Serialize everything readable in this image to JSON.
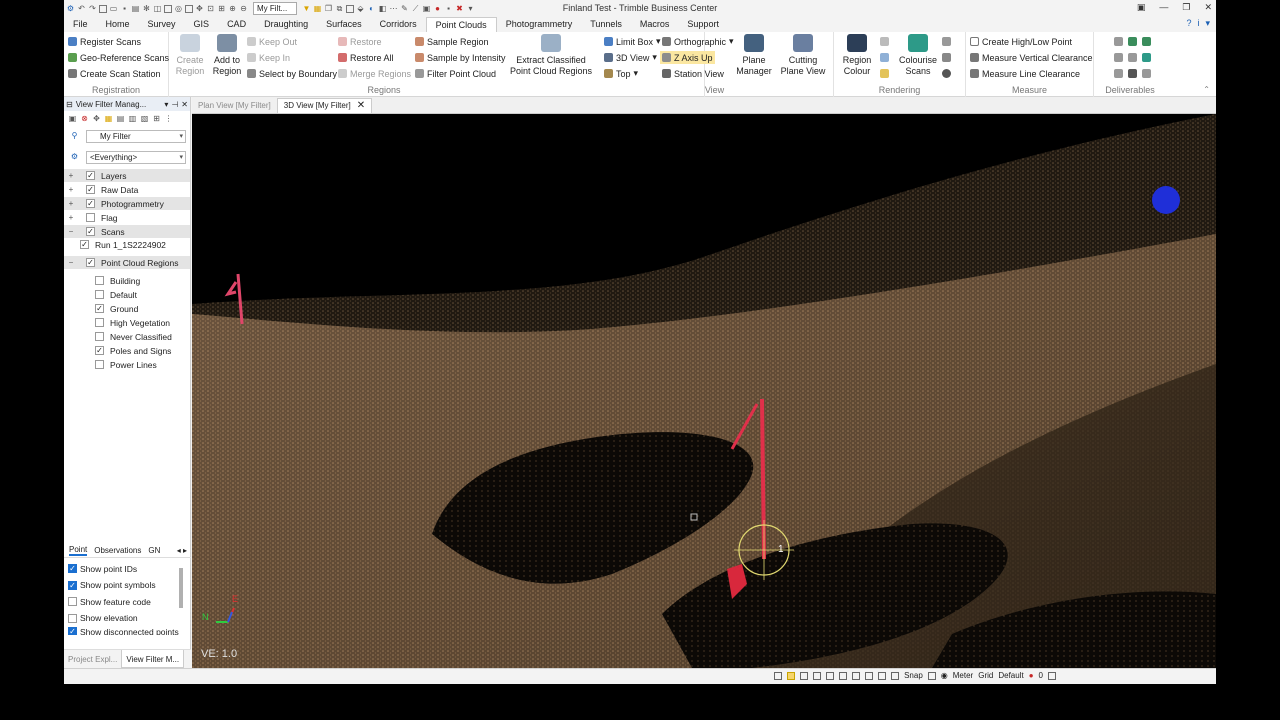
{
  "window": {
    "title": "Finland Test - Trimble Business Center",
    "qat_filter": "My Filt..."
  },
  "tabs": [
    "File",
    "Home",
    "Survey",
    "GIS",
    "CAD",
    "Draughting",
    "Surfaces",
    "Corridors",
    "Point Clouds",
    "Photogrammetry",
    "Tunnels",
    "Macros",
    "Support"
  ],
  "active_tab": "Point Clouds",
  "ribbon": {
    "registration": {
      "label": "Registration",
      "items": [
        "Register Scans",
        "Geo-Reference Scans",
        "Create Scan Station"
      ]
    },
    "regions": {
      "label": "Regions",
      "create_region": "Create Region",
      "add_to_region": "Add to Region",
      "keep_out": "Keep Out",
      "keep_in": "Keep In",
      "select_by_boundary": "Select by Boundary",
      "restore": "Restore",
      "restore_all": "Restore All",
      "merge_regions": "Merge Regions",
      "sample_region": "Sample Region",
      "sample_by_intensity": "Sample by Intensity",
      "filter_point_cloud": "Filter Point Cloud",
      "extract_classified": "Extract Classified Point Cloud Regions"
    },
    "view": {
      "label": "View",
      "limit_box": "Limit Box",
      "orthographic": "Orthographic",
      "view_3d": "3D View",
      "z_axis_up": "Z Axis Up",
      "top": "Top",
      "station_view": "Station View",
      "plane_manager": "Plane Manager",
      "cutting_plane_view": "Cutting Plane View"
    },
    "rendering": {
      "label": "Rendering",
      "region_colour": "Region Colour",
      "colourise_scans": "Colourise Scans"
    },
    "measure": {
      "label": "Measure",
      "items": [
        "Create High/Low Point",
        "Measure Vertical Clearance",
        "Measure Line Clearance"
      ]
    },
    "deliverables": {
      "label": "Deliverables"
    }
  },
  "left_panel": {
    "title": "View Filter Manag...",
    "filter": "My Filter",
    "everything": "<Everything>",
    "tree": [
      {
        "label": "Layers",
        "checked": true,
        "expand": "+"
      },
      {
        "label": "Raw Data",
        "checked": true,
        "expand": "+"
      },
      {
        "label": "Photogrammetry",
        "checked": true,
        "expand": "+"
      },
      {
        "label": "Flag",
        "checked": false,
        "expand": "+"
      },
      {
        "label": "Scans",
        "checked": true,
        "expand": "−"
      }
    ],
    "scan_run": "Run 1_1S2224902",
    "pcr_label": "Point Cloud Regions",
    "regions": [
      {
        "label": "Building",
        "checked": false
      },
      {
        "label": "Default",
        "checked": false
      },
      {
        "label": "Ground",
        "checked": true
      },
      {
        "label": "High Vegetation",
        "checked": false
      },
      {
        "label": "Never Classified",
        "checked": false
      },
      {
        "label": "Poles and Signs",
        "checked": true
      },
      {
        "label": "Power Lines",
        "checked": false
      }
    ],
    "bottom_tabs": [
      "Point",
      "Observations",
      "GN"
    ],
    "options": [
      {
        "label": "Show point IDs",
        "checked": true
      },
      {
        "label": "Show point symbols",
        "checked": true
      },
      {
        "label": "Show feature code",
        "checked": false
      },
      {
        "label": "Show elevation",
        "checked": false
      },
      {
        "label": "Show disconnected points",
        "checked": true
      }
    ],
    "footer_tabs": [
      "Project Expl...",
      "View Filter M..."
    ]
  },
  "doc_tabs": [
    "Plan View [My Filter]",
    "3D View [My Filter]"
  ],
  "viewport": {
    "ve_label": "VE: 1.0",
    "point_label": "1"
  },
  "status": {
    "snap": "Snap",
    "units": "Meter",
    "grid": "Grid",
    "default": "Default",
    "count": "0"
  }
}
